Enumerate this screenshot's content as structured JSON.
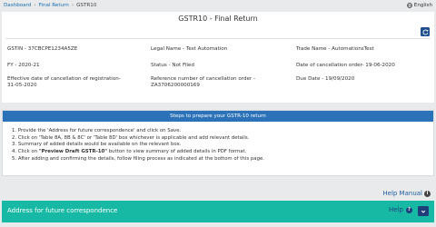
{
  "breadcrumb": {
    "items": [
      "Dashboard",
      "Final Return"
    ],
    "current": "GSTR10"
  },
  "language": {
    "label": "English",
    "icon": "globe-icon"
  },
  "header": {
    "title": "GSTR10 - Final Return",
    "refresh_icon": "refresh-icon"
  },
  "taxpayer": {
    "gstin": "GSTIN - 37CBCPE1234A5ZE",
    "legal_name": "Legal Name - Test Automation",
    "trade_name": "Trade Name - AutomationsTest",
    "fy": "FY - 2020-21",
    "status": "Status - Not Filed",
    "cancellation_order_date": "Date of cancellation order- 19-06-2020",
    "effective_date_label": "Effective date of cancellation of registration-",
    "effective_date_value": "31-05-2020",
    "reference_label": "Reference number of cancellation order -",
    "reference_value": "ZA3706200000169",
    "due_date": "Due Date - 19/09/2020"
  },
  "steps": {
    "title": "Steps to prepare your GSTR-10 return",
    "items": [
      {
        "text": "1. Provide the 'Address for future correspondence' and click on Save."
      },
      {
        "text": "2. Click on 'Table 8A, 8B & 8C' or 'Table 8D' box whichever is applicable and add relevant details."
      },
      {
        "text": "3. Summary of added details would be available on the relevant box."
      },
      {
        "pre": "4. Click on ",
        "bold": "\"Preview Draft GSTR-10\"",
        "post": " button to view summary of added details in PDF format."
      },
      {
        "text": "5. After adding and confirming the details, follow filing process as indicated at the bottom of this page."
      }
    ]
  },
  "help_manual": {
    "label": "Help Manual",
    "icon": "info-icon"
  },
  "accordion": {
    "title": "Address for future correspondence",
    "help_label": "Help",
    "help_icon": "question-icon",
    "toggle_icon": "chevron-down-icon"
  },
  "colors": {
    "link": "#1a6fb5",
    "header_blue": "#2b72b8",
    "accordion_teal": "#17b9a4",
    "dark_navy": "#1f3f7a"
  }
}
